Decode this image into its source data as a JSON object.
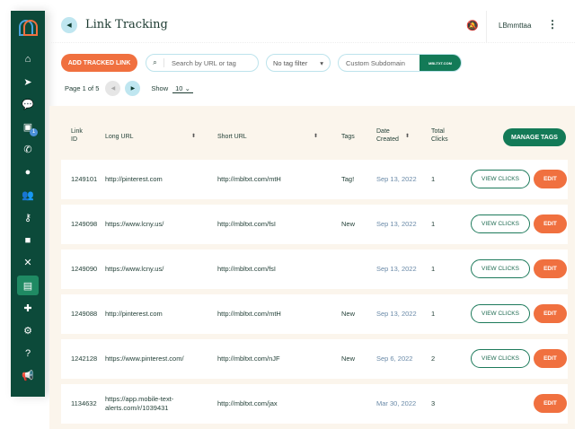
{
  "sidebar": {
    "items": [
      {
        "icon": "home-icon",
        "glyph": "⌂"
      },
      {
        "icon": "send-icon",
        "glyph": "➤"
      },
      {
        "icon": "chat-icon",
        "glyph": "💬"
      },
      {
        "icon": "inbox-icon",
        "glyph": "▣",
        "badge": "1"
      },
      {
        "icon": "phone-icon",
        "glyph": "✆"
      },
      {
        "icon": "person-icon",
        "glyph": "●"
      },
      {
        "icon": "group-icon",
        "glyph": "👥"
      },
      {
        "icon": "key-icon",
        "glyph": "⚷"
      },
      {
        "icon": "bag-icon",
        "glyph": "■"
      },
      {
        "icon": "shuffle-icon",
        "glyph": "✕"
      },
      {
        "icon": "document-icon",
        "glyph": "▤",
        "active": true
      },
      {
        "icon": "puzzle-icon",
        "glyph": "✚"
      },
      {
        "icon": "gear-icon",
        "glyph": "⚙"
      },
      {
        "icon": "help-icon",
        "glyph": "?"
      },
      {
        "icon": "megaphone-icon",
        "glyph": "📢"
      }
    ]
  },
  "header": {
    "title": "Link Tracking",
    "user": "LBmmttaa"
  },
  "toolbar": {
    "add_label": "ADD TRACKED LINK",
    "search_placeholder": "Search by URL or tag",
    "tag_filter": "No tag filter",
    "subdomain_placeholder": "Custom Subdomain",
    "domain": "MBLTXT.COM"
  },
  "pager": {
    "page_text": "Page 1 of 5",
    "show_label": "Show",
    "show_value": "10"
  },
  "table": {
    "headers": {
      "id": [
        "Link",
        "ID"
      ],
      "long": "Long URL",
      "short": "Short URL",
      "tags": "Tags",
      "date": [
        "Date",
        "Created"
      ],
      "clicks": [
        "Total",
        "Clicks"
      ]
    },
    "manage_label": "MANAGE TAGS",
    "view_label": "VIEW CLICKS",
    "edit_label": "EDIT",
    "rows": [
      {
        "id": "1249101",
        "long": "http://pinterest.com",
        "short": "http://mbltxt.com/mtH",
        "tags": "Tag!",
        "date": "Sep 13, 2022",
        "clicks": "1",
        "view": true
      },
      {
        "id": "1249098",
        "long": "https://www.lcny.us/",
        "short": "http://mbltxt.com/fsI",
        "tags": "New",
        "date": "Sep 13, 2022",
        "clicks": "1",
        "view": true
      },
      {
        "id": "1249090",
        "long": "https://www.lcny.us/",
        "short": "http://mbltxt.com/fsI",
        "tags": "",
        "date": "Sep 13, 2022",
        "clicks": "1",
        "view": true
      },
      {
        "id": "1249088",
        "long": "http://pinterest.com",
        "short": "http://mbltxt.com/mtH",
        "tags": "New",
        "date": "Sep 13, 2022",
        "clicks": "1",
        "view": true
      },
      {
        "id": "1242128",
        "long": "https://www.pinterest.com/",
        "short": "http://mbltxt.com/nJF",
        "tags": "New",
        "date": "Sep 6, 2022",
        "clicks": "2",
        "view": true
      },
      {
        "id": "1134632",
        "long": "https://app.mobile-text-alerts.com/r/1039431",
        "short": "http://mbltxt.com/jax",
        "tags": "",
        "date": "Mar 30, 2022",
        "clicks": "3",
        "view": false
      }
    ]
  }
}
